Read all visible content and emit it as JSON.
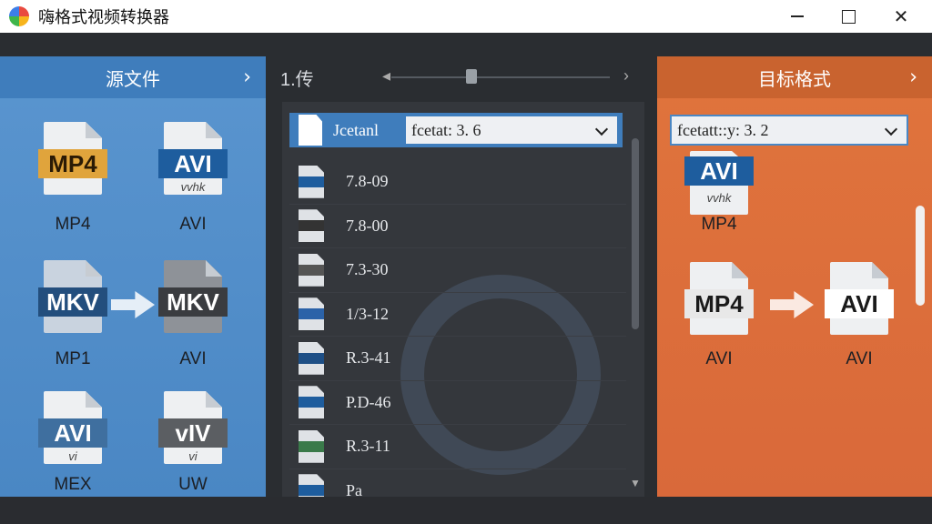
{
  "window": {
    "title": "嗨格式视频转换器"
  },
  "source_panel": {
    "header": "源文件",
    "files": [
      {
        "tag": "MP4",
        "sub": "",
        "label": "MP4",
        "tag_color": "#e0a43c"
      },
      {
        "tag": "AVI",
        "sub": "vvhk",
        "label": "AVI",
        "tag_color": "#1e5d9e"
      },
      {
        "tag": "MKV",
        "sub": "",
        "label": "MP1",
        "tag_color": "#234e7d"
      },
      {
        "tag": "MKV",
        "sub": "",
        "label": "AVI",
        "tag_color": "#3a3c40"
      },
      {
        "tag": "AVI",
        "sub": "vi",
        "label": "MEX",
        "tag_color": "#3f6f9f"
      },
      {
        "tag": "vIV",
        "sub": "vi",
        "label": "UW",
        "tag_color": "#5b5e62"
      }
    ]
  },
  "middle": {
    "top_label": "1.传",
    "header_label": "Jcetanl",
    "format_select": "fcetat: 3. 6",
    "rows": [
      "7.8-09",
      "7.8-00",
      "7.3-30",
      "1/3-12",
      "R.3-41",
      "P.D-46",
      "R.3-11",
      "Pa"
    ]
  },
  "target_panel": {
    "header": "目标格式",
    "format_select": "fcetatt::y: 3. 2",
    "files": [
      {
        "tag": "AVI",
        "sub": "vvhk",
        "label": "MP4",
        "tag_color": "#1e5d9e"
      },
      {
        "tag": "MP4",
        "sub": "",
        "label": "AVI",
        "tag_color": "#e8e8e8"
      },
      {
        "tag": "AVI",
        "sub": "",
        "label": "AVI",
        "tag_color": "#ffffff"
      }
    ]
  }
}
